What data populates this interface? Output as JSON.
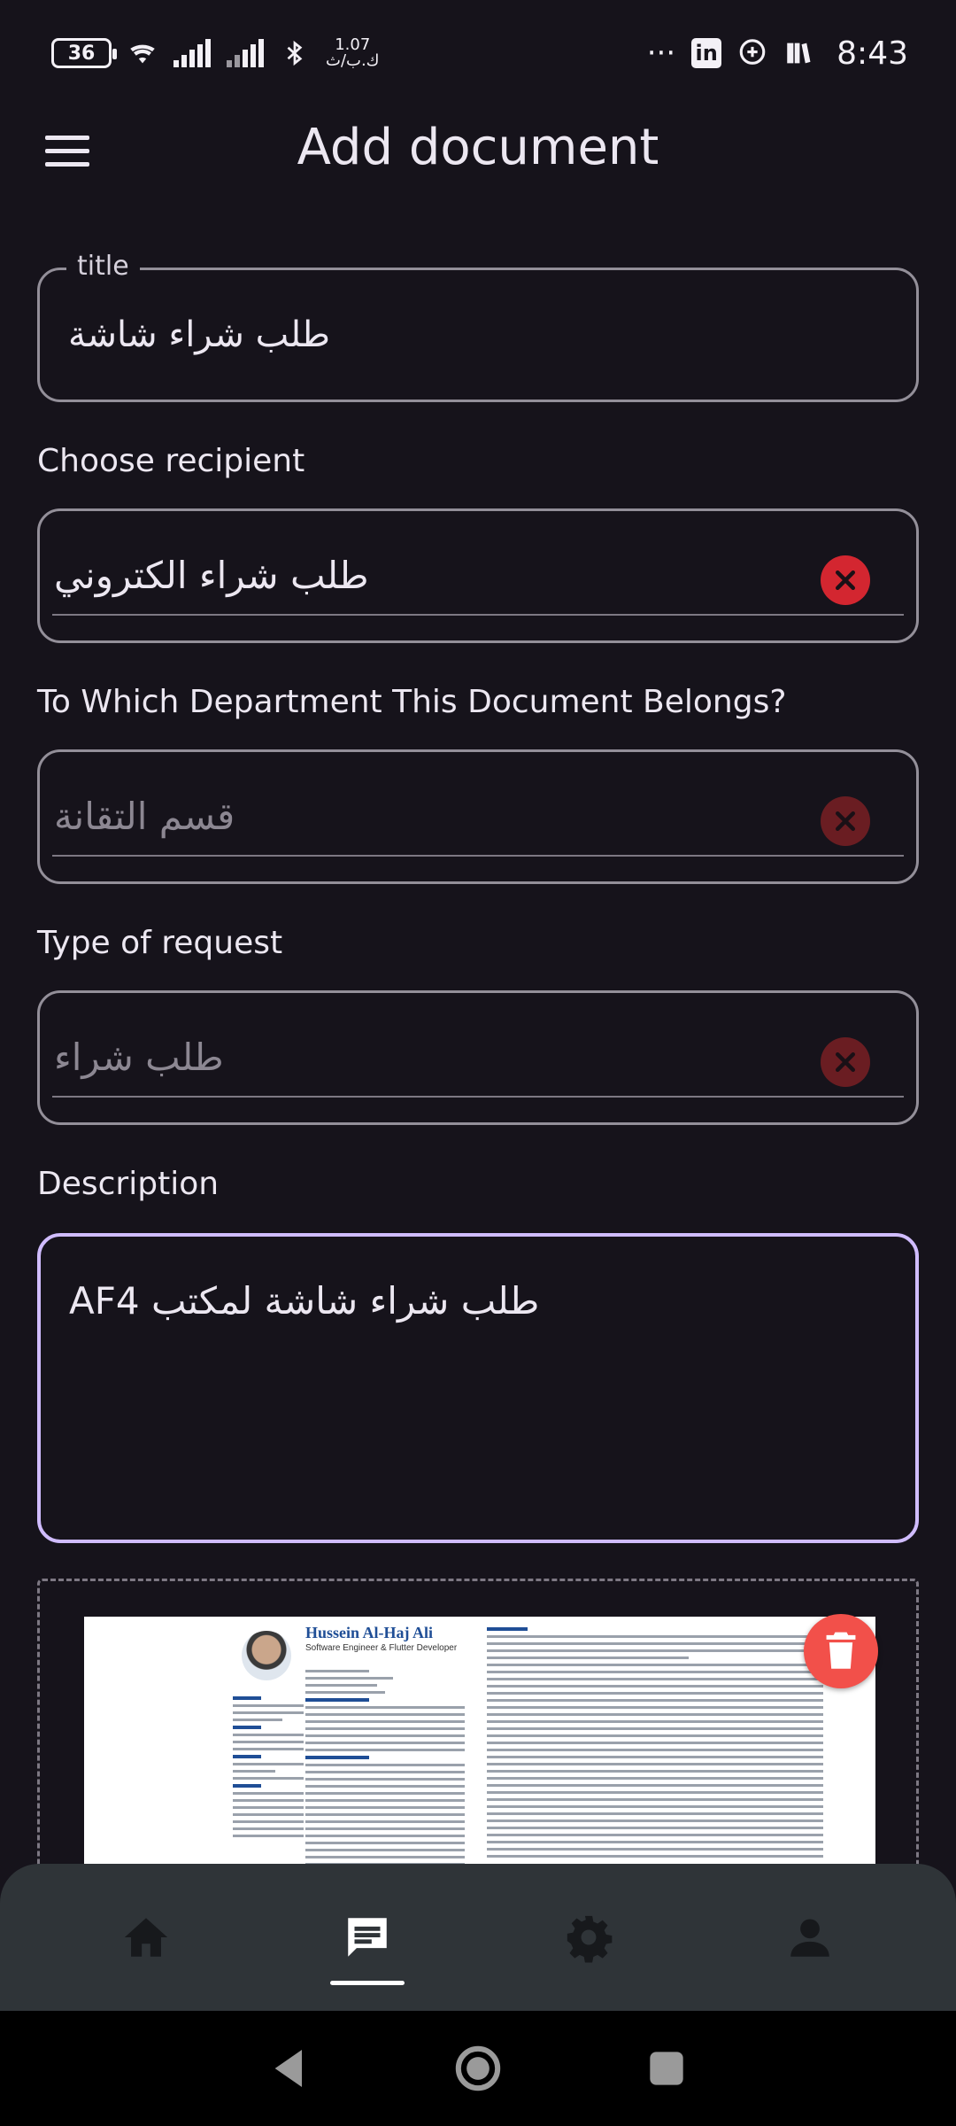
{
  "status_bar": {
    "battery": "36",
    "speed_value": "1.07",
    "speed_unit": "ك.ب/ث",
    "more": "···",
    "linkedin": "in",
    "time": "8:43"
  },
  "app_bar": {
    "title": "Add document",
    "menu_icon": "hamburger-menu-icon"
  },
  "form": {
    "title_field": {
      "label": "title",
      "value": "طلب شراء شاشة"
    },
    "recipient": {
      "label": "Choose recipient",
      "value": "طلب شراء الكتروني"
    },
    "department": {
      "label": "To Which Department This Document Belongs?",
      "placeholder": "قسم التقانة"
    },
    "request_type": {
      "label": "Type of request",
      "placeholder": "طلب شراء"
    },
    "description": {
      "label": "Description",
      "value": "طلب شراء شاشة لمكتب AF4"
    }
  },
  "attachment": {
    "doc_name": "Hussein Al-Haj Ali",
    "doc_role": "Software Engineer & Flutter Developer",
    "delete_icon": "trash-icon"
  },
  "bottom_nav": {
    "items": [
      {
        "name": "home",
        "icon": "home-icon",
        "active": false
      },
      {
        "name": "documents",
        "icon": "message-icon",
        "active": true
      },
      {
        "name": "settings",
        "icon": "gear-icon",
        "active": false
      },
      {
        "name": "profile",
        "icon": "person-icon",
        "active": false
      }
    ]
  },
  "colors": {
    "background": "#16131b",
    "accent_outline": "#d0bcff",
    "clear_button": "#d32630",
    "delete_fab": "#f2504a",
    "nav_bar": "#2f3438"
  }
}
